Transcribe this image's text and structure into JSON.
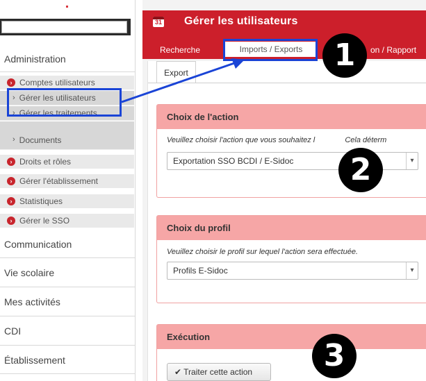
{
  "sidebar": {
    "search": {
      "value": "",
      "placeholder": ""
    },
    "administration": "Administration",
    "comptes_utilisateurs": "Comptes utilisateurs",
    "gerer_utilisateurs": "Gérer les utilisateurs",
    "gerer_traitements": "Gérer les traitements",
    "documents": "Documents",
    "droits_roles": "Droits et rôles",
    "gerer_etablissement": "Gérer l'établissement",
    "statistiques": "Statistiques",
    "gerer_sso": "Gérer le SSO",
    "communication": "Communication",
    "vie_scolaire": "Vie scolaire",
    "mes_activites": "Mes activités",
    "cdi": "CDI",
    "etablissement": "Établissement"
  },
  "header": {
    "calendar_day": "31",
    "title": "Gérer les utilisateurs"
  },
  "tabs": {
    "recherche": "Recherche",
    "imports_exports": "Imports / Exports",
    "partial_third": "on / Rapport"
  },
  "subtab": {
    "export": "Export"
  },
  "panels": {
    "action": {
      "title": "Choix de l'action",
      "hint": "Veuillez choisir l'action que vous souhaitez l",
      "hint_tail": "Cela déterm",
      "selected": "Exportation SSO BCDI / E-Sidoc"
    },
    "profil": {
      "title": "Choix du profil",
      "hint": "Veuillez choisir le profil sur lequel l'action sera effectuée.",
      "selected": "Profils E-Sidoc"
    },
    "execution": {
      "title": "Exécution",
      "button": "✔ Traiter cette action"
    }
  },
  "annotations": {
    "one": "1",
    "two": "2",
    "three": "3"
  },
  "colors": {
    "accent": "#cc1f2b",
    "panel_head": "#f6a6a6",
    "highlight": "#1a44d6"
  }
}
